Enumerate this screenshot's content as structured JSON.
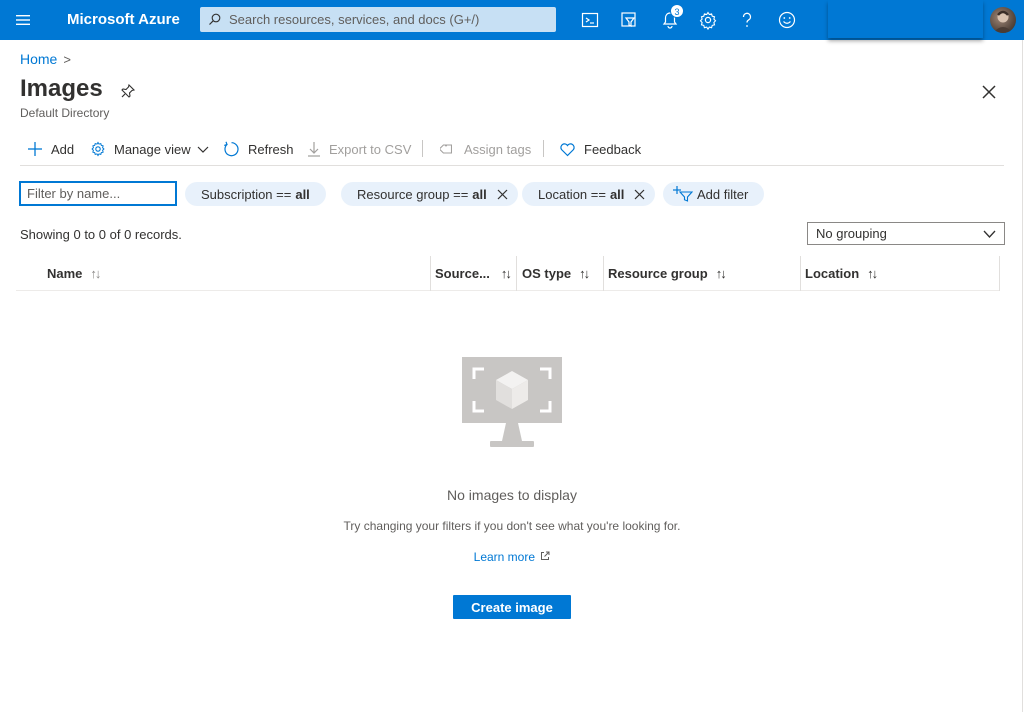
{
  "topbar": {
    "brand": "Microsoft Azure",
    "search_placeholder": "Search resources, services, and docs (G+/)",
    "notification_count": "3",
    "accent_color": "#0078d4"
  },
  "breadcrumb": {
    "home": "Home"
  },
  "page": {
    "title": "Images",
    "subtitle": "Default Directory"
  },
  "toolbar": {
    "add": "Add",
    "manage_view": "Manage view",
    "refresh": "Refresh",
    "export_csv": "Export to CSV",
    "assign_tags": "Assign tags",
    "feedback": "Feedback"
  },
  "filters": {
    "name_placeholder": "Filter by name...",
    "subscription": {
      "label": "Subscription ==",
      "value": "all"
    },
    "resource_group": {
      "label": "Resource group ==",
      "value": "all"
    },
    "location": {
      "label": "Location ==",
      "value": "all"
    },
    "add_filter": "Add filter"
  },
  "records_text": "Showing 0 to 0 of 0 records.",
  "grouping": {
    "selected": "No grouping"
  },
  "table": {
    "columns": [
      "Name",
      "Source...",
      "OS type",
      "Resource group",
      "Location"
    ],
    "sort_glyph": "↑↓"
  },
  "empty": {
    "title": "No images to display",
    "subtitle": "Try changing your filters if you don't see what you're looking for.",
    "learn_more": "Learn more",
    "create_button": "Create image"
  }
}
